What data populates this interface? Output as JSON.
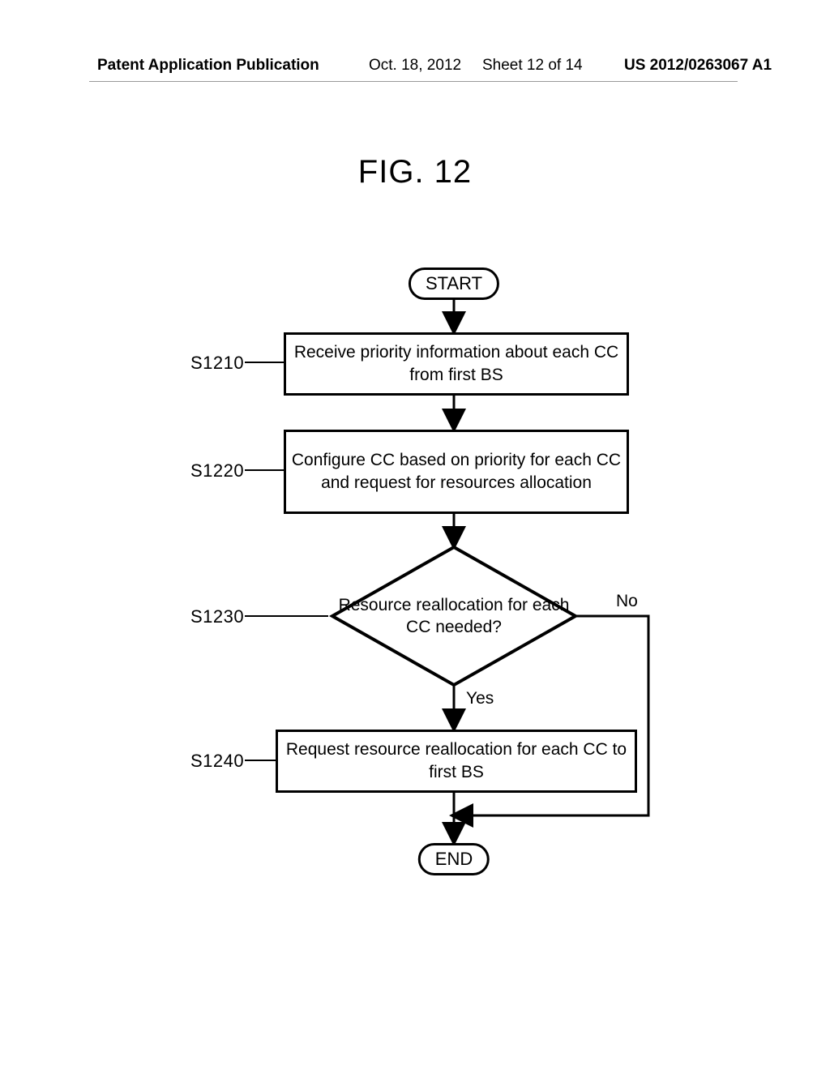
{
  "header": {
    "publication": "Patent Application Publication",
    "date": "Oct. 18, 2012",
    "sheet": "Sheet 12 of 14",
    "appno": "US 2012/0263067 A1"
  },
  "figure_title": "FIG. 12",
  "nodes": {
    "start": "START",
    "s1210": "Receive priority information about each CC from first BS",
    "s1220": "Configure CC based on priority for each CC and request for resources allocation",
    "s1230": "Resource reallocation for each CC needed?",
    "s1240": "Request resource reallocation for each CC to first BS",
    "end": "END"
  },
  "step_labels": {
    "s1210": "S1210",
    "s1220": "S1220",
    "s1230": "S1230",
    "s1240": "S1240"
  },
  "edges": {
    "yes": "Yes",
    "no": "No"
  }
}
